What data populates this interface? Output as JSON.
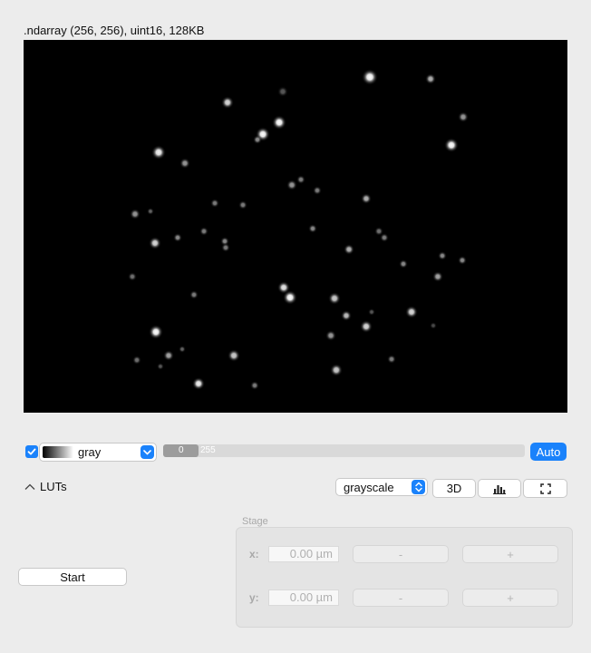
{
  "image": {
    "title": ".ndarray (256, 256), uint16, 128KB"
  },
  "channel": {
    "visible": true,
    "colormap": "gray",
    "contrast_min": "0",
    "contrast_max": "255",
    "contrast_fill_fraction": 0.098,
    "auto_label": "Auto",
    "accent_color": "#1a82fb"
  },
  "luts": {
    "toggle_label": "LUTs",
    "toggle_icon": "chevron-up-icon"
  },
  "view": {
    "mode": "grayscale",
    "btn_3d_label": "3D",
    "histogram_icon": "histogram-icon",
    "fullscreen_icon": "fullscreen-icon"
  },
  "controls": {
    "start_label": "Start"
  },
  "stage": {
    "title": "Stage",
    "x_label": "x:",
    "y_label": "y:",
    "x_value": "0.00 µm",
    "y_value": "0.00 µm",
    "minus_label": "-",
    "plus_label": "+"
  }
}
